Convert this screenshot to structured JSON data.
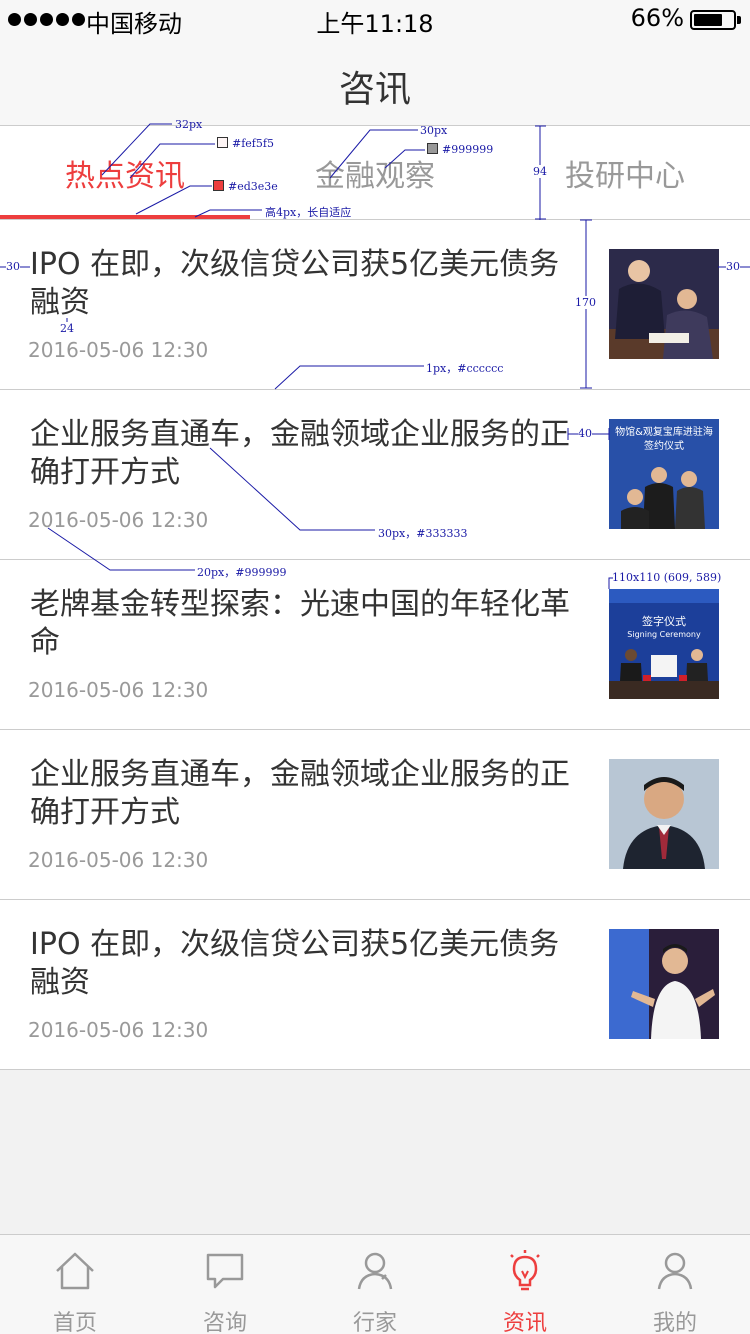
{
  "status_bar": {
    "carrier": "中国移动",
    "time": "上午11:18",
    "battery": "66%"
  },
  "header": {
    "title": "咨讯"
  },
  "tabs": [
    {
      "label": "热点资讯",
      "active": true
    },
    {
      "label": "金融观察",
      "active": false
    },
    {
      "label": "投研中心",
      "active": false
    }
  ],
  "articles": [
    {
      "title": "IPO 在即，次级信贷公司获5亿美元债务融资",
      "time": "2016-05-06 12:30",
      "image": "signing-ceremony-photo"
    },
    {
      "title": "企业服务直通车，金融领域企业服务的正确打开方式",
      "time": "2016-05-06 12:30",
      "image": "signing-ceremony-photo",
      "image_caption": "物馆&观复宝库进驻海 签约仪式"
    },
    {
      "title": "老牌基金转型探索：光速中国的年轻化革命",
      "time": "2016-05-06 12:30",
      "image": "signing-ceremony-photo",
      "image_caption": "签字仪式 Signing Ceremony"
    },
    {
      "title": "企业服务直通车，金融领域企业服务的正确打开方式",
      "time": "2016-05-06 12:30",
      "image": "portrait-photo"
    },
    {
      "title": "IPO 在即，次级信贷公司获5亿美元债务融资",
      "time": "2016-05-06 12:30",
      "image": "speaker-photo"
    }
  ],
  "annotations": {
    "tab_font": "32px",
    "tab_bg": "#fef5f5",
    "tab_active_color": "#ed3e3e",
    "tab_font_2": "30px",
    "tab_inactive_color": "#999999",
    "underline": "高4px，长自适应",
    "tab_height": "94",
    "item_height": "170",
    "padding": "30",
    "padding_right": "30",
    "title_gap": "24",
    "divider": "1px，#cccccc",
    "image_gap": "40",
    "title_spec": "30px，#333333",
    "time_spec": "20px，#999999",
    "image_spec": "110x110 (609, 589)"
  },
  "tab_bar": [
    {
      "label": "首页",
      "icon": "home-icon",
      "active": false
    },
    {
      "label": "咨询",
      "icon": "chat-icon",
      "active": false
    },
    {
      "label": "行家",
      "icon": "person-icon",
      "active": false
    },
    {
      "label": "资讯",
      "icon": "lightbulb-icon",
      "active": true
    },
    {
      "label": "我的",
      "icon": "user-icon",
      "active": false
    }
  ],
  "colors": {
    "accent": "#ed3e3e",
    "text": "#333333",
    "secondary": "#999999",
    "divider": "#cccccc",
    "annotation": "#1a1aa6"
  }
}
